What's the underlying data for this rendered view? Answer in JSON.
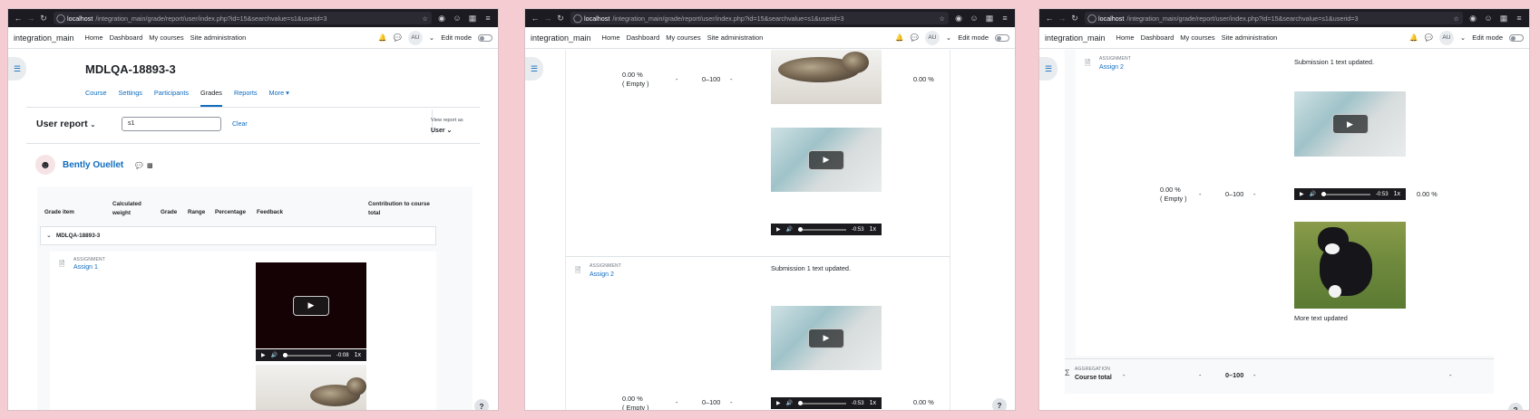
{
  "browser": {
    "url_host": "localhost",
    "url_path": "/integration_main/grade/report/user/index.php?id=15&searchvalue=s1&userid=3"
  },
  "nav": {
    "brand": "integration_main",
    "links": [
      "Home",
      "Dashboard",
      "My courses",
      "Site administration"
    ],
    "avatar_initials": "AU",
    "edit_mode_label": "Edit mode"
  },
  "course": {
    "title": "MDLQA-18893-3",
    "tabs": [
      "Course",
      "Settings",
      "Participants",
      "Grades",
      "Reports",
      "More"
    ],
    "active_tab": "Grades"
  },
  "report": {
    "selector_label": "User report",
    "search_value": "s1",
    "clear_label": "Clear",
    "view_as_label": "View report as",
    "view_as_value": "User"
  },
  "user": {
    "name": "Bently Ouellet"
  },
  "table": {
    "headers": {
      "grade_item": "Grade item",
      "calculated_weight": "Calculated weight",
      "grade": "Grade",
      "range": "Range",
      "percentage": "Percentage",
      "feedback": "Feedback",
      "contribution": "Contribution to course total"
    },
    "category_name": "MDLQA-18893-3",
    "item_type_label": "ASSIGNMENT",
    "assign1": "Assign 1",
    "assign2": "Assign 2",
    "weight": "0.00 %",
    "weight_empty": "( Empty )",
    "grade": "-",
    "range": "0–100",
    "percentage": "-",
    "contribution": "0.00 %",
    "feedback_text_1": "Submission 1 text updated.",
    "feedback_text_2": "More text updated",
    "video_time_1": "-0:08",
    "video_time_2": "-0:53",
    "speed": "1x",
    "aggregation_label": "AGGREGATION",
    "course_total_label": "Course total",
    "course_total_weight": "-",
    "course_total_grade": "-",
    "course_total_range": "0–100",
    "course_total_percentage": "-",
    "course_total_contribution": "-"
  },
  "help_label": "?"
}
